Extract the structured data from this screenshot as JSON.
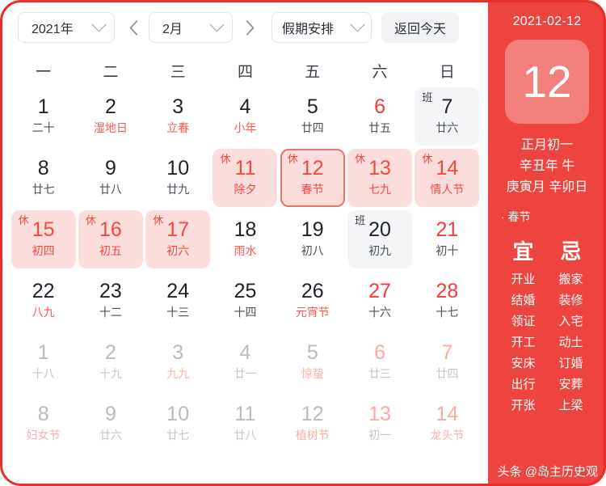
{
  "toolbar": {
    "year_label": "2021年",
    "month_label": "2月",
    "holiday_label": "假期安排",
    "today_label": "返回今天",
    "prev_icon": "chevron-left-icon",
    "next_icon": "chevron-right-icon"
  },
  "weekdays": [
    "一",
    "二",
    "三",
    "四",
    "五",
    "六",
    "日"
  ],
  "weeks": [
    [
      {
        "day": "1",
        "lunar": "二十",
        "fest": false,
        "weekend": false,
        "tag": "",
        "state": "normal"
      },
      {
        "day": "2",
        "lunar": "湿地日",
        "fest": true,
        "weekend": false,
        "tag": "",
        "state": "normal"
      },
      {
        "day": "3",
        "lunar": "立春",
        "fest": true,
        "weekend": false,
        "tag": "",
        "state": "normal"
      },
      {
        "day": "4",
        "lunar": "小年",
        "fest": true,
        "weekend": false,
        "tag": "",
        "state": "normal"
      },
      {
        "day": "5",
        "lunar": "廿四",
        "fest": false,
        "weekend": false,
        "tag": "",
        "state": "normal"
      },
      {
        "day": "6",
        "lunar": "廿五",
        "fest": false,
        "weekend": true,
        "tag": "",
        "state": "normal"
      },
      {
        "day": "7",
        "lunar": "廿六",
        "fest": false,
        "weekend": true,
        "tag": "班",
        "state": "work"
      }
    ],
    [
      {
        "day": "8",
        "lunar": "廿七",
        "fest": false,
        "weekend": false,
        "tag": "",
        "state": "normal"
      },
      {
        "day": "9",
        "lunar": "廿八",
        "fest": false,
        "weekend": false,
        "tag": "",
        "state": "normal"
      },
      {
        "day": "10",
        "lunar": "廿九",
        "fest": false,
        "weekend": false,
        "tag": "",
        "state": "normal"
      },
      {
        "day": "11",
        "lunar": "除夕",
        "fest": true,
        "weekend": false,
        "tag": "休",
        "state": "rest"
      },
      {
        "day": "12",
        "lunar": "春节",
        "fest": true,
        "weekend": false,
        "tag": "休",
        "state": "rest selected"
      },
      {
        "day": "13",
        "lunar": "七九",
        "fest": false,
        "weekend": true,
        "tag": "休",
        "state": "rest"
      },
      {
        "day": "14",
        "lunar": "情人节",
        "fest": true,
        "weekend": true,
        "tag": "休",
        "state": "rest"
      }
    ],
    [
      {
        "day": "15",
        "lunar": "初四",
        "fest": false,
        "weekend": false,
        "tag": "休",
        "state": "rest"
      },
      {
        "day": "16",
        "lunar": "初五",
        "fest": false,
        "weekend": false,
        "tag": "休",
        "state": "rest"
      },
      {
        "day": "17",
        "lunar": "初六",
        "fest": false,
        "weekend": false,
        "tag": "休",
        "state": "rest"
      },
      {
        "day": "18",
        "lunar": "雨水",
        "fest": true,
        "weekend": false,
        "tag": "",
        "state": "normal"
      },
      {
        "day": "19",
        "lunar": "初八",
        "fest": false,
        "weekend": false,
        "tag": "",
        "state": "normal"
      },
      {
        "day": "20",
        "lunar": "初九",
        "fest": false,
        "weekend": true,
        "tag": "班",
        "state": "work"
      },
      {
        "day": "21",
        "lunar": "初十",
        "fest": false,
        "weekend": true,
        "tag": "",
        "state": "normal"
      }
    ],
    [
      {
        "day": "22",
        "lunar": "八九",
        "fest": true,
        "weekend": false,
        "tag": "",
        "state": "normal"
      },
      {
        "day": "23",
        "lunar": "十二",
        "fest": false,
        "weekend": false,
        "tag": "",
        "state": "normal"
      },
      {
        "day": "24",
        "lunar": "十三",
        "fest": false,
        "weekend": false,
        "tag": "",
        "state": "normal"
      },
      {
        "day": "25",
        "lunar": "十四",
        "fest": false,
        "weekend": false,
        "tag": "",
        "state": "normal"
      },
      {
        "day": "26",
        "lunar": "元宵节",
        "fest": true,
        "weekend": false,
        "tag": "",
        "state": "normal"
      },
      {
        "day": "27",
        "lunar": "十六",
        "fest": false,
        "weekend": true,
        "tag": "",
        "state": "normal"
      },
      {
        "day": "28",
        "lunar": "十七",
        "fest": false,
        "weekend": true,
        "tag": "",
        "state": "normal"
      }
    ],
    [
      {
        "day": "1",
        "lunar": "十八",
        "fest": false,
        "weekend": false,
        "tag": "",
        "state": "out"
      },
      {
        "day": "2",
        "lunar": "十九",
        "fest": false,
        "weekend": false,
        "tag": "",
        "state": "out"
      },
      {
        "day": "3",
        "lunar": "九九",
        "fest": true,
        "weekend": false,
        "tag": "",
        "state": "out"
      },
      {
        "day": "4",
        "lunar": "廿一",
        "fest": false,
        "weekend": false,
        "tag": "",
        "state": "out"
      },
      {
        "day": "5",
        "lunar": "惊蛰",
        "fest": true,
        "weekend": false,
        "tag": "",
        "state": "out"
      },
      {
        "day": "6",
        "lunar": "廿三",
        "fest": false,
        "weekend": true,
        "tag": "",
        "state": "out"
      },
      {
        "day": "7",
        "lunar": "廿四",
        "fest": false,
        "weekend": true,
        "tag": "",
        "state": "out"
      }
    ],
    [
      {
        "day": "8",
        "lunar": "妇女节",
        "fest": true,
        "weekend": false,
        "tag": "",
        "state": "out"
      },
      {
        "day": "9",
        "lunar": "廿六",
        "fest": false,
        "weekend": false,
        "tag": "",
        "state": "out"
      },
      {
        "day": "10",
        "lunar": "廿七",
        "fest": false,
        "weekend": false,
        "tag": "",
        "state": "out"
      },
      {
        "day": "11",
        "lunar": "廿八",
        "fest": false,
        "weekend": false,
        "tag": "",
        "state": "out"
      },
      {
        "day": "12",
        "lunar": "植树节",
        "fest": true,
        "weekend": false,
        "tag": "",
        "state": "out"
      },
      {
        "day": "13",
        "lunar": "初一",
        "fest": false,
        "weekend": true,
        "tag": "",
        "state": "out"
      },
      {
        "day": "14",
        "lunar": "龙头节",
        "fest": true,
        "weekend": true,
        "tag": "",
        "state": "out"
      }
    ]
  ],
  "panel": {
    "date": "2021-02-12",
    "big_day": "12",
    "lunar_line1": "正月初一",
    "lunar_line2": "辛丑年 牛",
    "lunar_line3": "庚寅月 辛卯日",
    "festival": "· 春节",
    "yi_title": "宜",
    "ji_title": "忌",
    "yi_items": [
      "开业",
      "结婚",
      "领证",
      "开工",
      "安床",
      "出行",
      "开张"
    ],
    "ji_items": [
      "搬家",
      "装修",
      "入宅",
      "动土",
      "订婚",
      "安葬",
      "上梁"
    ]
  },
  "watermark": "头条 @岛主历史观",
  "colors": {
    "brand_red": "#ee4440",
    "frame_red": "#e8302a",
    "rest_bg": "#fbdedc",
    "rest_text": "#f5483f",
    "work_bg": "#f4f5f6",
    "weekend_text": "#fa3a3a",
    "selected_border": "#f0706a"
  }
}
